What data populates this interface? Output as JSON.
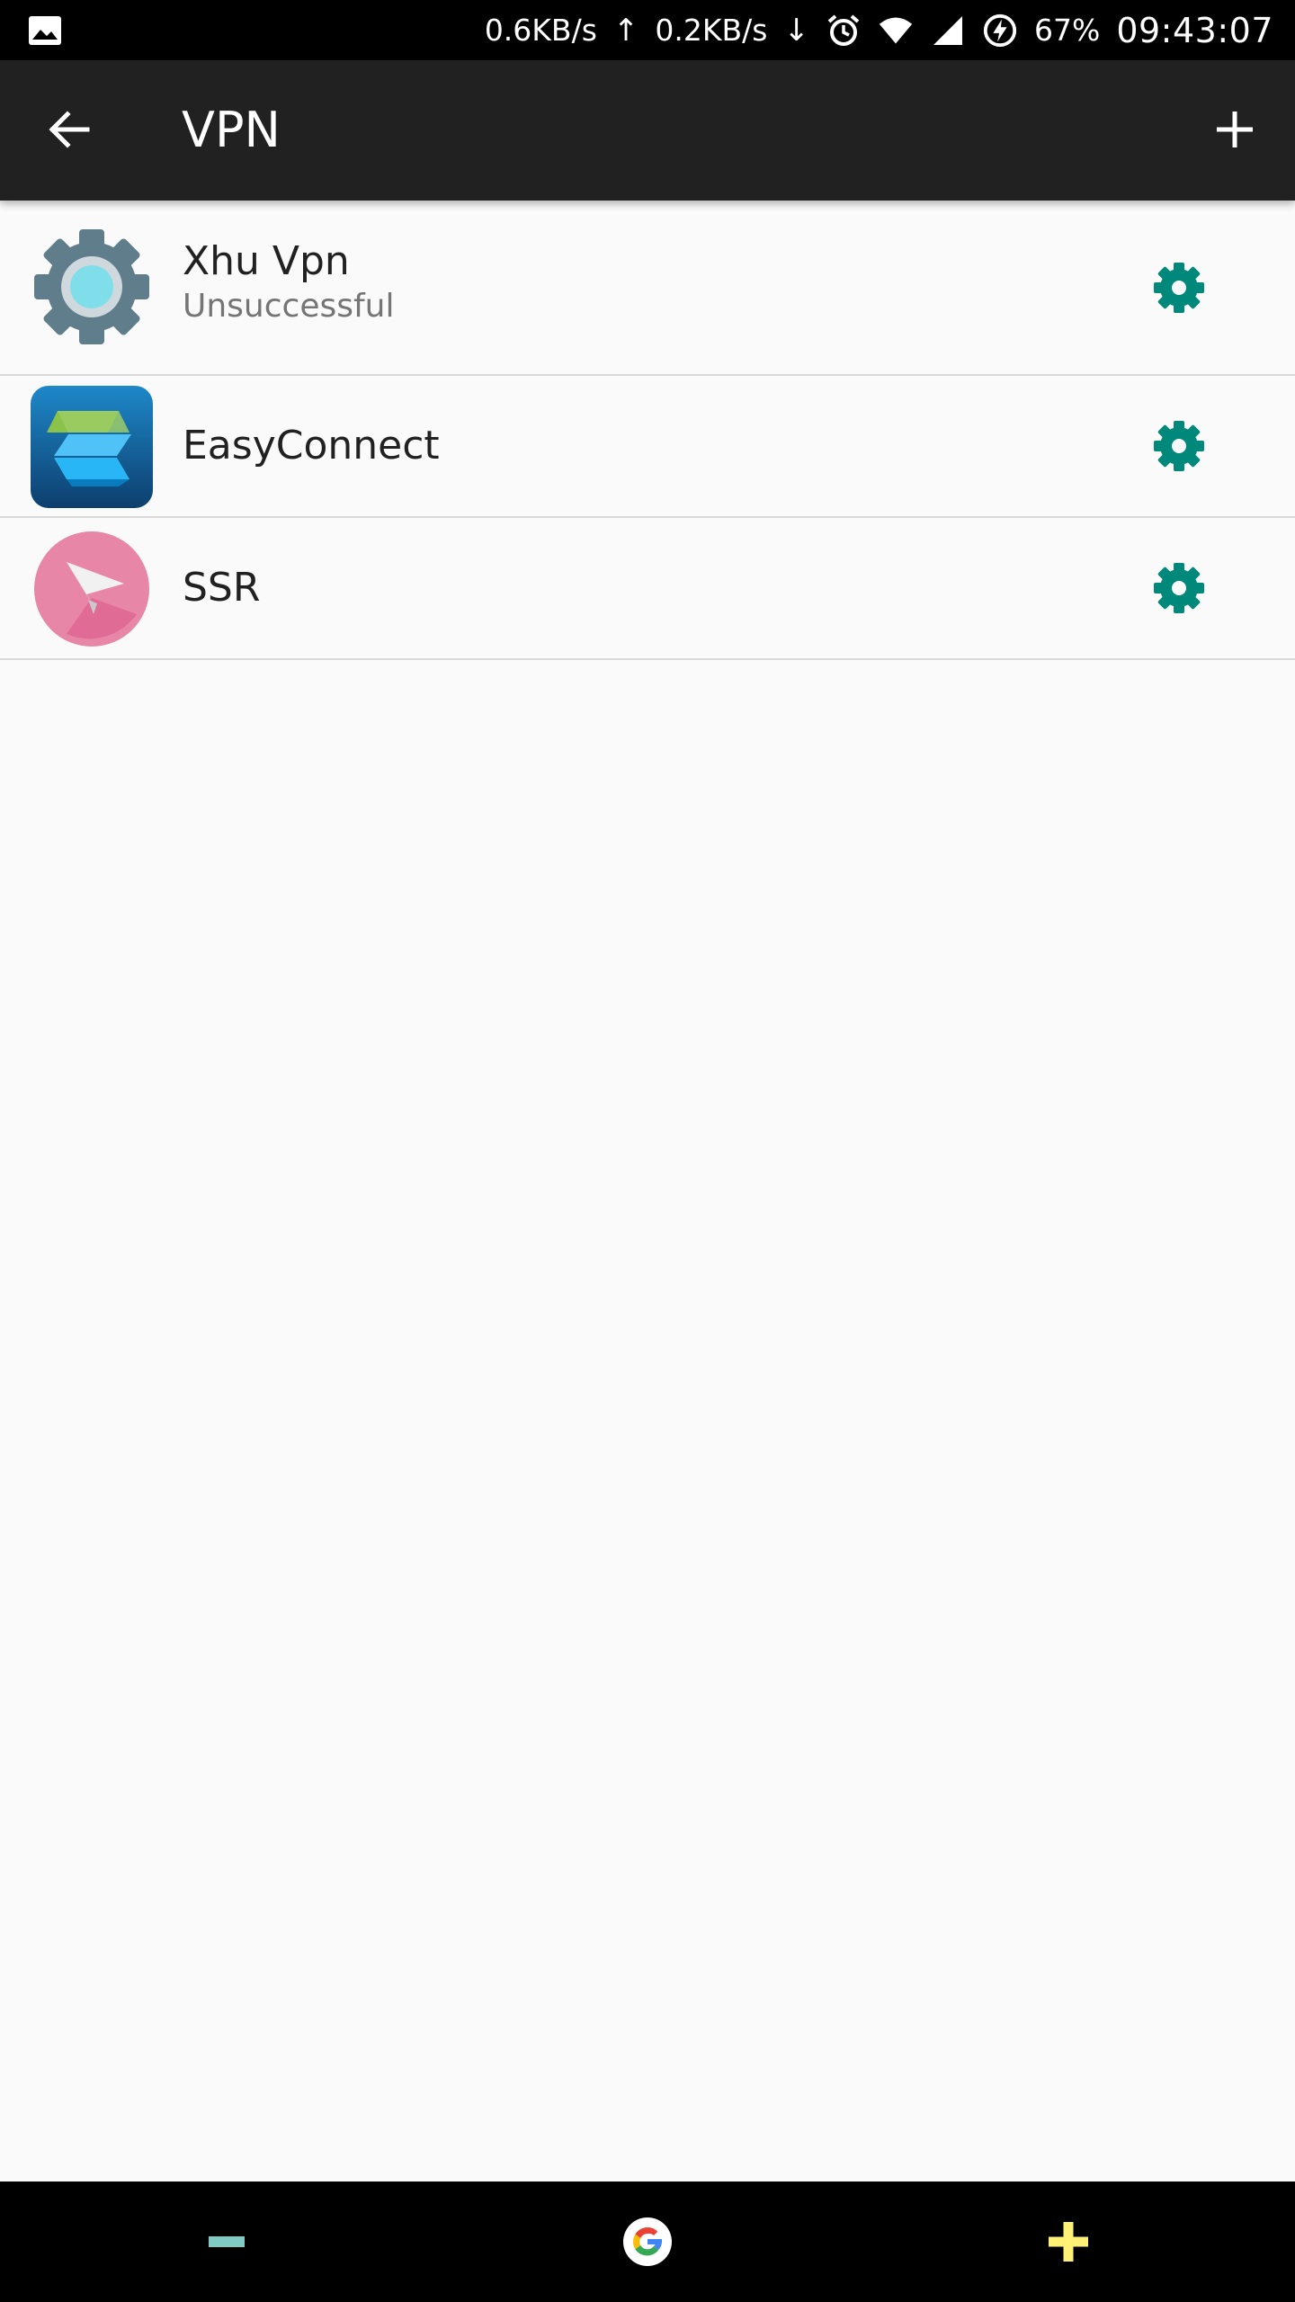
{
  "status_bar": {
    "up_speed": "0.6KB/s",
    "up_arrow": "↑",
    "down_speed": "0.2KB/s",
    "down_arrow": "↓",
    "battery": "67%",
    "time": "09:43:07",
    "icons": [
      "image-icon",
      "alarm-icon",
      "wifi-icon",
      "signal-icon",
      "battery-charging-icon"
    ]
  },
  "app_bar": {
    "title": "VPN",
    "back_icon": "arrow-back-icon",
    "add_icon": "plus-icon"
  },
  "vpn_profiles": [
    {
      "name": "Xhu Vpn",
      "status": "Unsuccessful",
      "icon": "gear-app-icon",
      "settings_icon": "settings-gear-icon"
    },
    {
      "name": "EasyConnect",
      "status": "",
      "icon": "easyconnect-app-icon",
      "settings_icon": "settings-gear-icon"
    },
    {
      "name": "SSR",
      "status": "",
      "icon": "paper-plane-app-icon",
      "settings_icon": "settings-gear-icon"
    }
  ],
  "bottom_nav": {
    "items": [
      "minus-icon",
      "google-icon",
      "plus-icon"
    ]
  },
  "colors": {
    "status_bar_bg": "#000000",
    "app_bar_bg": "#212121",
    "list_bg": "#fafafa",
    "settings_accent": "#00897b",
    "divider": "#d9d9d9",
    "nav_minus": "#80cbc4",
    "nav_plus": "#fff176"
  }
}
